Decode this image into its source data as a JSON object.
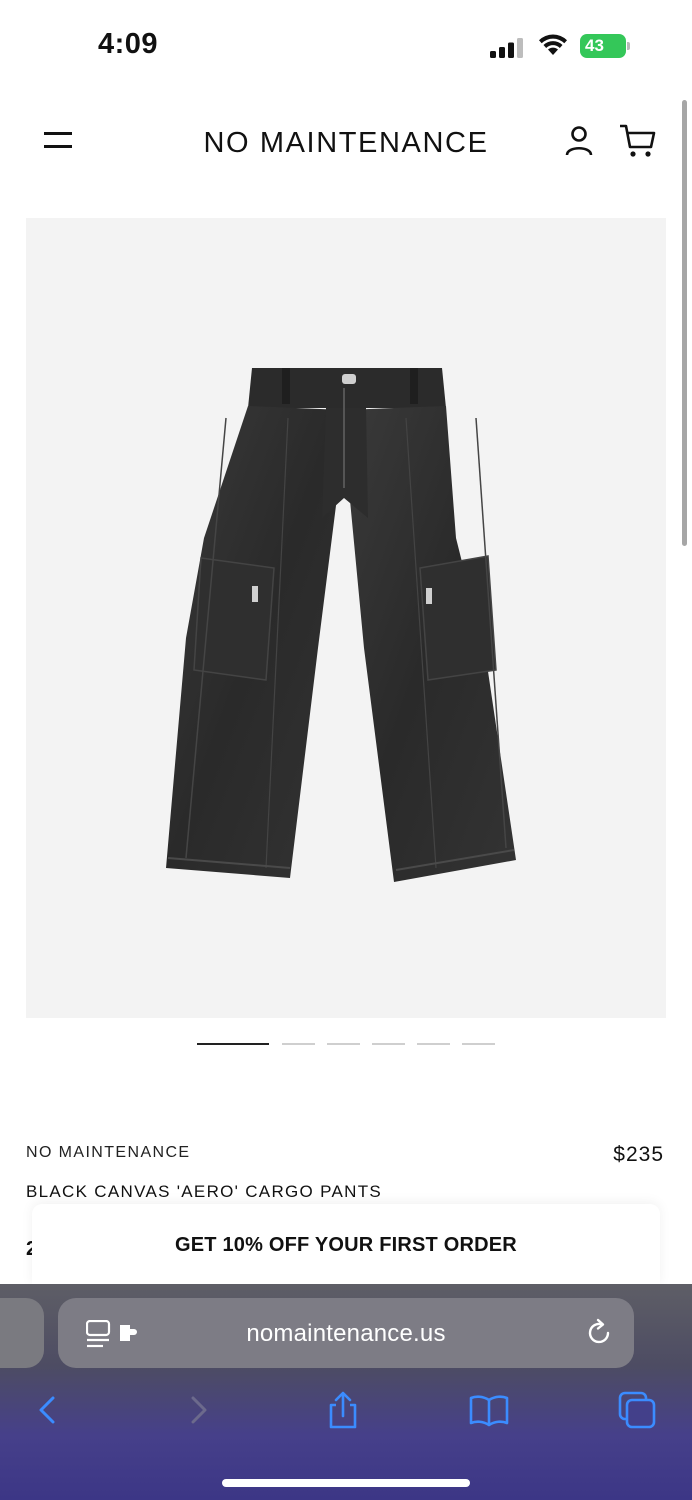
{
  "status_bar": {
    "time": "4:09",
    "battery_level": "43"
  },
  "header": {
    "brand": "NO MAINTENANCE"
  },
  "product": {
    "image_alt": "Black canvas cargo pants",
    "carousel_total": 6,
    "carousel_active": 1,
    "vendor": "NO MAINTENANCE",
    "price": "$235",
    "title": "BLACK CANVAS 'AERO' CARGO PANTS",
    "peek_text": "2"
  },
  "promo": {
    "text": "GET 10% OFF YOUR FIRST ORDER"
  },
  "browser": {
    "url": "nomaintenance.us"
  },
  "icons": {
    "menu": "menu-icon",
    "account": "account-icon",
    "cart": "cart-icon",
    "reader": "reader-icon",
    "reload": "reload-icon",
    "back": "chevron-left-icon",
    "forward": "chevron-right-icon",
    "share": "share-icon",
    "bookmarks": "book-icon",
    "tabs": "tabs-icon"
  },
  "colors": {
    "accent_blue": "#3b8cff",
    "battery_green": "#34c759"
  }
}
